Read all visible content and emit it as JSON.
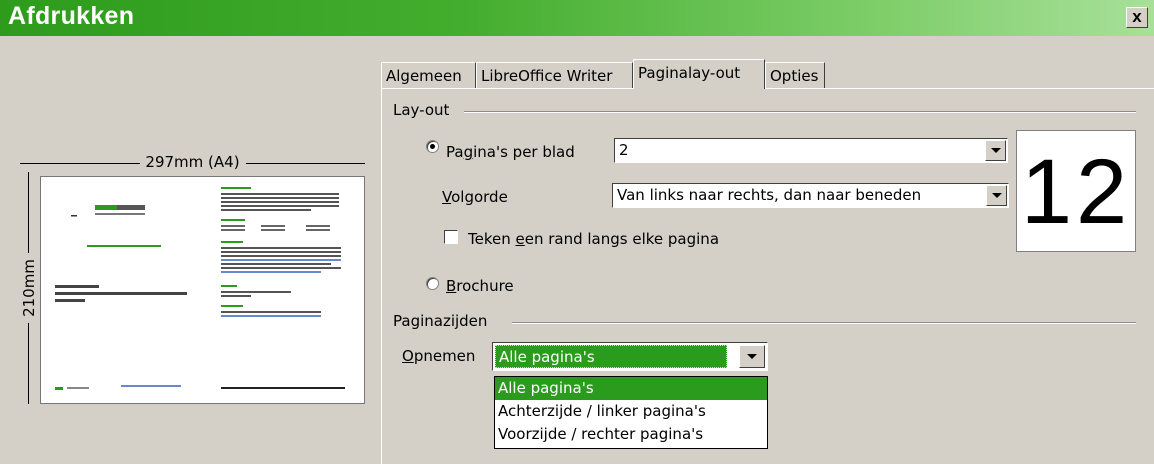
{
  "window": {
    "title": "Afdrukken",
    "close_symbol": "x"
  },
  "preview": {
    "width_label": "297mm (A4)",
    "height_label": "210mm"
  },
  "tabs": [
    {
      "label": "Algemeen"
    },
    {
      "label": "LibreOffice Writer"
    },
    {
      "label": "Paginalay-out",
      "active": true
    },
    {
      "label": "Opties"
    }
  ],
  "layout_section": {
    "label": "Lay-out",
    "pages_per_sheet_radio": {
      "pre": "Pa",
      "mnemonic": "g",
      "post": "ina's per blad",
      "selected": true
    },
    "pages_per_sheet_value": "2",
    "order": {
      "mnemonic": "V",
      "rest": "olgorde",
      "value": "Van links naar rechts, dan naar beneden"
    },
    "border_checkbox": {
      "pre": "Teken ",
      "mnemonic": "e",
      "post": "en rand langs elke pagina",
      "checked": false
    },
    "brochure_radio": {
      "mnemonic": "B",
      "rest": "rochure",
      "selected": false
    },
    "preview_number": "12"
  },
  "page_sides_section": {
    "label": "Paginazijden",
    "include": {
      "mnemonic": "O",
      "rest": "pnemen",
      "value": "Alle pagina's"
    },
    "dropdown_options": [
      "Alle pagina's",
      "Achterzijde / linker pagina's",
      "Voorzijde / rechter pagina's"
    ]
  },
  "colors": {
    "accent_green": "#2b9b1e",
    "titlebar_start": "#2e9b1c",
    "titlebar_end": "#a8e09a",
    "dialog_bg": "#d4d0c8"
  }
}
